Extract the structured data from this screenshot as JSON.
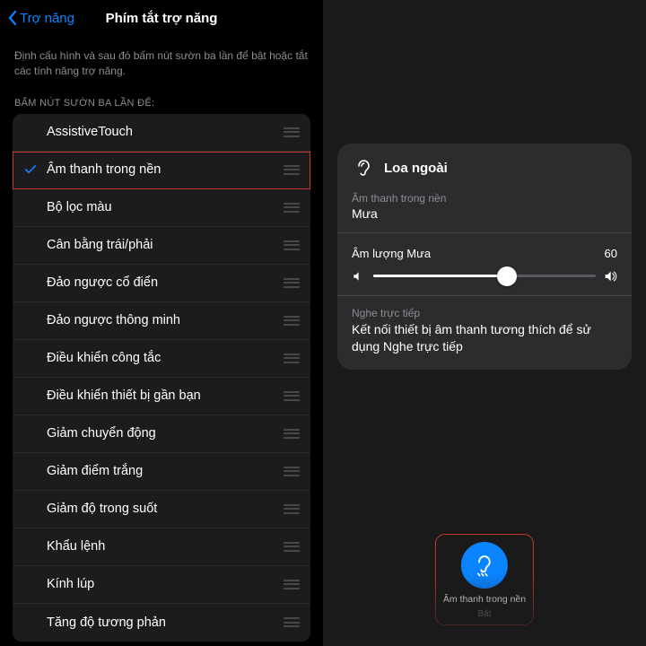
{
  "left": {
    "back_label": "Trợ năng",
    "title": "Phím tắt trợ năng",
    "description": "Định cấu hình và sau đó bấm nút sườn ba lần để bật hoặc tắt các tính năng trợ năng.",
    "section_header": "BẤM NÚT SƯỜN BA LẦN ĐỂ:",
    "items": [
      {
        "label": "AssistiveTouch",
        "checked": false,
        "highlight": false
      },
      {
        "label": "Âm thanh trong nền",
        "checked": true,
        "highlight": true
      },
      {
        "label": "Bộ lọc màu",
        "checked": false,
        "highlight": false
      },
      {
        "label": "Cân bằng trái/phải",
        "checked": false,
        "highlight": false
      },
      {
        "label": "Đảo ngược cổ điển",
        "checked": false,
        "highlight": false
      },
      {
        "label": "Đảo ngược thông minh",
        "checked": false,
        "highlight": false
      },
      {
        "label": "Điều khiển công tắc",
        "checked": false,
        "highlight": false
      },
      {
        "label": "Điều khiển thiết bị gần bạn",
        "checked": false,
        "highlight": false
      },
      {
        "label": "Giảm chuyển động",
        "checked": false,
        "highlight": false
      },
      {
        "label": "Giảm điểm trắng",
        "checked": false,
        "highlight": false
      },
      {
        "label": "Giảm độ trong suốt",
        "checked": false,
        "highlight": false
      },
      {
        "label": "Khẩu lệnh",
        "checked": false,
        "highlight": false
      },
      {
        "label": "Kính lúp",
        "checked": false,
        "highlight": false
      },
      {
        "label": "Tăng độ tương phản",
        "checked": false,
        "highlight": false
      }
    ]
  },
  "right": {
    "card": {
      "title": "Loa ngoài",
      "bg_label": "Âm thanh trong nền",
      "bg_value": "Mưa",
      "vol_label": "Âm lượng Mưa",
      "vol_value": "60",
      "vol_percent": 60,
      "listen_label": "Nghe trực tiếp",
      "listen_msg": "Kết nối thiết bị âm thanh tương thích để sử dụng Nghe trực tiếp"
    },
    "button": {
      "label": "Âm thanh trong nền",
      "state": "Bật"
    }
  },
  "colors": {
    "accent": "#0a84ff",
    "highlight": "#c0392b"
  }
}
